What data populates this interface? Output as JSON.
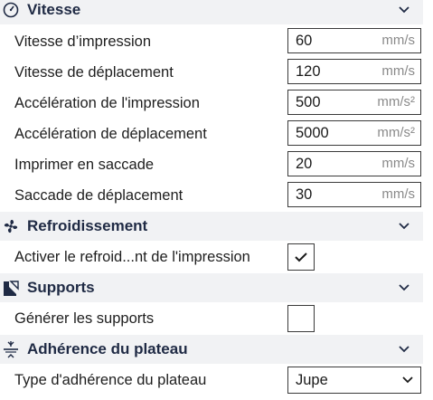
{
  "sections": {
    "vitesse": {
      "title": "Vitesse",
      "icon": "speed-gauge-icon",
      "rows": [
        {
          "label": "Vitesse d’impression",
          "value": "60",
          "unit": "mm/s"
        },
        {
          "label": "Vitesse de déplacement",
          "value": "120",
          "unit": "mm/s"
        },
        {
          "label": "Accélération de l'impression",
          "value": "500",
          "unit": "mm/s²"
        },
        {
          "label": "Accélération de déplacement",
          "value": "5000",
          "unit": "mm/s²"
        },
        {
          "label": "Imprimer en saccade",
          "value": "20",
          "unit": "mm/s"
        },
        {
          "label": "Saccade de déplacement",
          "value": "30",
          "unit": "mm/s"
        }
      ]
    },
    "refroidissement": {
      "title": "Refroidissement",
      "icon": "fan-icon",
      "rows": [
        {
          "label": "Activer le refroid...nt de l'impression",
          "checked": true
        }
      ]
    },
    "supports": {
      "title": "Supports",
      "icon": "support-icon",
      "rows": [
        {
          "label": "Générer les supports",
          "checked": false
        }
      ]
    },
    "adherence": {
      "title": "Adhérence du plateau",
      "icon": "bed-adhesion-icon",
      "rows": [
        {
          "label": "Type d'adhérence du plateau",
          "value": "Jupe"
        }
      ]
    }
  },
  "colors": {
    "header_bg": "#f1f2f4",
    "header_text": "#1f2a44",
    "border": "#3a3a3a",
    "unit_text": "#8a8a8a"
  }
}
